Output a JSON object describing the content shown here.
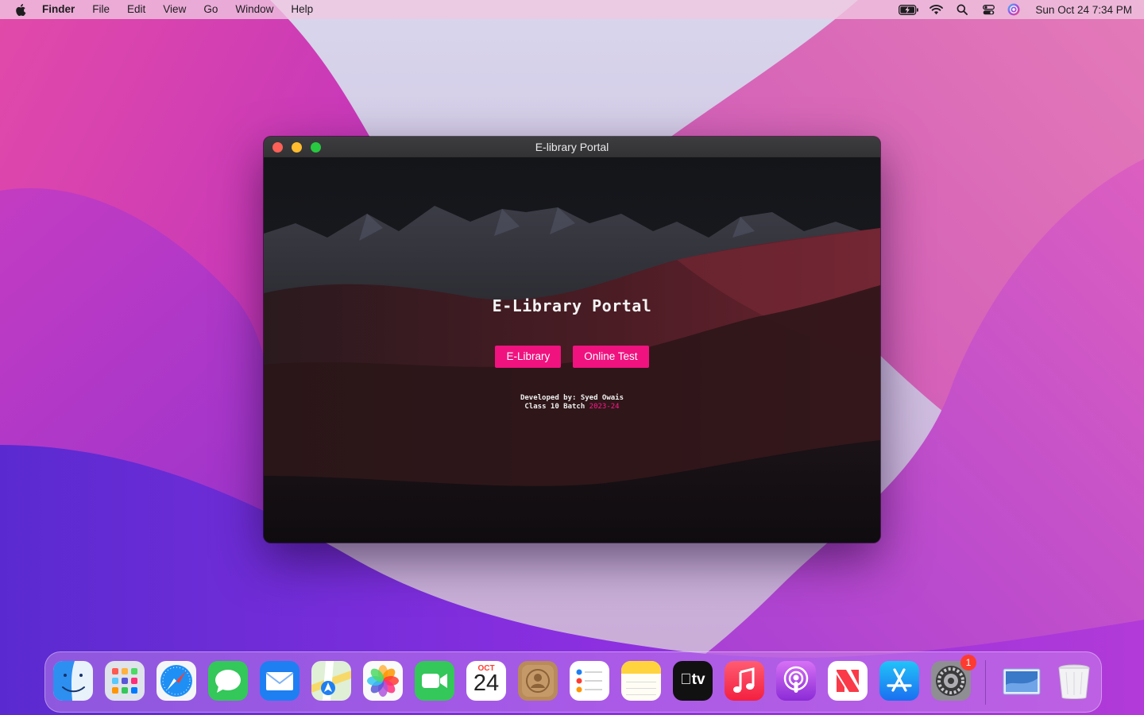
{
  "menubar": {
    "app_name": "Finder",
    "menus": [
      "File",
      "Edit",
      "View",
      "Go",
      "Window",
      "Help"
    ],
    "status_icons": [
      "battery-charging-icon",
      "wifi-icon",
      "spotlight-search-icon",
      "control-center-icon",
      "siri-icon"
    ],
    "clock": "Sun Oct 24  7:34 PM"
  },
  "window": {
    "title": "E-library Portal",
    "traffic_lights": {
      "close": "#fe5f57",
      "minimize": "#febc2e",
      "zoom": "#28c840"
    }
  },
  "page": {
    "heading": "E-Library Portal",
    "buttons": {
      "library": "E-Library",
      "test": "Online Test"
    },
    "credits": {
      "developer": "Developed by: Syed Owais",
      "batch_label": "Class 10 Batch",
      "batch_year": "2023-24"
    },
    "accent_color": "#f0127f"
  },
  "dock": {
    "apps": [
      "Finder",
      "Launchpad",
      "Safari",
      "Messages",
      "Mail",
      "Maps",
      "Photos",
      "FaceTime",
      "Calendar",
      "Contacts",
      "Reminders",
      "Notes",
      "TV",
      "Music",
      "Podcasts",
      "News",
      "App Store",
      "System Preferences",
      "Downloads",
      "Trash"
    ],
    "calendar": {
      "month": "OCT",
      "day": "24"
    },
    "tv_label": "tv",
    "system_preferences_badge": "1"
  }
}
